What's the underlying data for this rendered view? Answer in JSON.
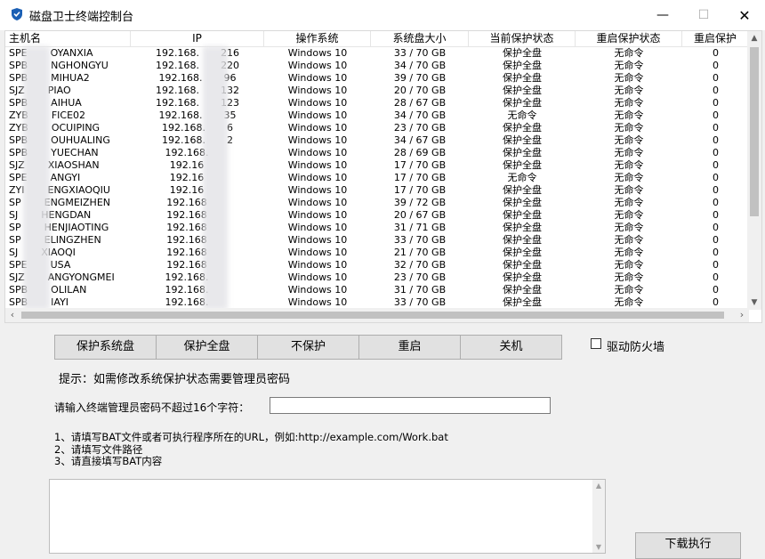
{
  "window": {
    "title": "磁盘卫士终端控制台",
    "minimize": "—",
    "maximize": "☐",
    "close": "✕"
  },
  "list": {
    "columns": [
      "主机名",
      "IP",
      "操作系统",
      "系统盘大小",
      "当前保护状态",
      "重启保护状态",
      "重启保护"
    ],
    "rows": [
      [
        "SPE",
        "OYANXIA",
        "192.168.",
        "216",
        "Windows 10",
        "33 / 70 GB",
        "保护全盘",
        "无命令",
        "0"
      ],
      [
        "SPB",
        "NGHONGYU",
        "192.168.",
        "220",
        "Windows 10",
        "34 / 70 GB",
        "保护全盘",
        "无命令",
        "0"
      ],
      [
        "SPB",
        "MIHUA2",
        "192.168.",
        "96",
        "Windows 10",
        "39 / 70 GB",
        "保护全盘",
        "无命令",
        "0"
      ],
      [
        "SJZ",
        "PIAO",
        "192.168.",
        "132",
        "Windows 10",
        "20 / 70 GB",
        "保护全盘",
        "无命令",
        "0"
      ],
      [
        "SPB",
        "AIHUA",
        "192.168.",
        "123",
        "Windows 10",
        "28 / 67 GB",
        "保护全盘",
        "无命令",
        "0"
      ],
      [
        "ZYB",
        "FICE02",
        "192.168.",
        "35",
        "Windows 10",
        "34 / 70 GB",
        "无命令",
        "无命令",
        "0"
      ],
      [
        "ZYB",
        "OCUIPING",
        "192.168.",
        "6",
        "Windows 10",
        "23 / 70 GB",
        "保护全盘",
        "无命令",
        "0"
      ],
      [
        "SPB",
        "OUHUALING",
        "192.168.",
        "2",
        "Windows 10",
        "34 / 67 GB",
        "保护全盘",
        "无命令",
        "0"
      ],
      [
        "SPB",
        "YUECHAN",
        "192.168.",
        "",
        "Windows 10",
        "28 / 69 GB",
        "保护全盘",
        "无命令",
        "0"
      ],
      [
        "SJZ",
        "XIAOSHAN",
        "192.16",
        "",
        "Windows 10",
        "17 / 70 GB",
        "保护全盘",
        "无命令",
        "0"
      ],
      [
        "SPE",
        "ANGYI",
        "192.16",
        "",
        "Windows 10",
        "17 / 70 GB",
        "无命令",
        "无命令",
        "0"
      ],
      [
        "ZYI",
        "ENGXIAOQIU",
        "192.16",
        "",
        "Windows 10",
        "17 / 70 GB",
        "保护全盘",
        "无命令",
        "0"
      ],
      [
        "SP",
        "ENGMEIZHEN",
        "192.168",
        "",
        "Windows 10",
        "39 / 72 GB",
        "保护全盘",
        "无命令",
        "0"
      ],
      [
        "SJ",
        "HENGDAN",
        "192.168",
        "",
        "Windows 10",
        "20 / 67 GB",
        "保护全盘",
        "无命令",
        "0"
      ],
      [
        "SP",
        "HENJIAOTING",
        "192.168",
        "",
        "Windows 10",
        "31 / 71 GB",
        "保护全盘",
        "无命令",
        "0"
      ],
      [
        "SP",
        "ELINGZHEN",
        "192.168",
        "",
        "Windows 10",
        "33 / 70 GB",
        "保护全盘",
        "无命令",
        "0"
      ],
      [
        "SJ",
        "XIAOQI",
        "192.168",
        "",
        "Windows 10",
        "21 / 70 GB",
        "保护全盘",
        "无命令",
        "0"
      ],
      [
        "SPE",
        "USA",
        "192.168",
        "",
        "Windows 10",
        "32 / 70 GB",
        "保护全盘",
        "无命令",
        "0"
      ],
      [
        "SJZ",
        "ANGYONGMEI",
        "192.168.",
        "",
        "Windows 10",
        "23 / 70 GB",
        "保护全盘",
        "无命令",
        "0"
      ],
      [
        "SPB",
        "OLILAN",
        "192.168.",
        "",
        "Windows 10",
        "31 / 70 GB",
        "保护全盘",
        "无命令",
        "0"
      ],
      [
        "SPB",
        "IAYI",
        "192.168.",
        "",
        "Windows 10",
        "33 / 70 GB",
        "保护全盘",
        "无命令",
        "0"
      ]
    ]
  },
  "buttons": {
    "protect_system": "保护系统盘",
    "protect_all": "保护全盘",
    "no_protect": "不保护",
    "restart": "重启",
    "shutdown": "关机"
  },
  "firewall": {
    "label": "驱动防火墙",
    "checked": false
  },
  "hint": "提示：如需修改系统保护状态需要管理员密码",
  "password": {
    "label": "请输入终端管理员密码不超过16个字符：",
    "value": ""
  },
  "instructions": [
    "1、请填写BAT文件或者可执行程序所在的URL，例如:http://example.com/Work.bat",
    "2、请填写文件路径",
    "3、请直接填写BAT内容"
  ],
  "bat_content": "",
  "run_button": "下载执行",
  "colors": {
    "shield": "#1a5fb4",
    "window_bg": "#f0f0f0",
    "button_bg": "#e1e1e1"
  }
}
